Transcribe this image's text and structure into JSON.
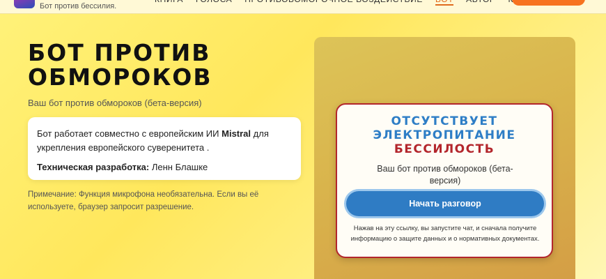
{
  "header": {
    "tagline": "Бот против бессилия.",
    "nav": [
      "КНИГА",
      "ГОЛОСА",
      "ПРОТИВОБОМОРОЧНОЕ ВОЗДЕЙСТВИЕ",
      "БОТ",
      "АВТОР",
      "КОНТАКТ"
    ],
    "active_nav": "БОТ",
    "accent_color": "#f7731f"
  },
  "hero": {
    "title": "БОТ ПРОТИВ ОБМОРОКОВ",
    "subtitle": "Ваш бот против обмороков (бета-версия)"
  },
  "info": {
    "line1_before": "Бот работает совместно с европейским ИИ ",
    "line1_bold": "Mistral",
    "line1_after": " для укрепления европейского суверенитета .",
    "dev_label": "Техническая разработка:",
    "dev_value": " Ленн Блашке"
  },
  "note": "Примечание: Функция микрофона необязательна. Если вы её используете, браузер запросит разрешение.",
  "chat_card": {
    "line1": "ОТСУТСТВУЕТ",
    "line2": "ЭЛЕКТРОПИТАНИЕ",
    "line3": "БЕССИЛОСТЬ",
    "subtitle": "Ваш бот против обмороков (бета-версия)",
    "button": "Начать разговор",
    "disclaimer": "Нажав на эту ссылку, вы запустите чат, и сначала получите информацию о защите данных и о нормативных документах.",
    "accent_blue": "#2e7ec6",
    "accent_red": "#b3262c"
  }
}
